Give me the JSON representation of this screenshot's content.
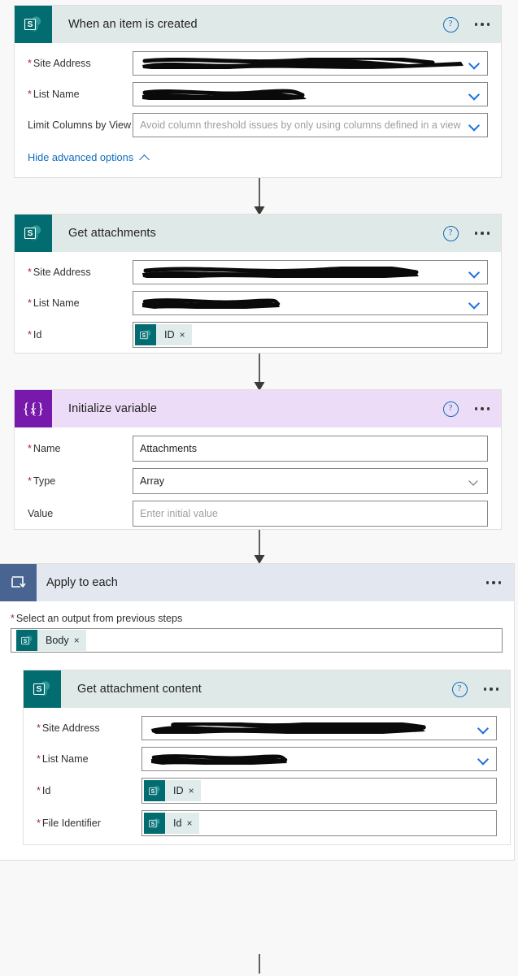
{
  "steps": [
    {
      "id": "when-item-created",
      "title": "When an item is created",
      "connector": "sharepoint",
      "icon": "sharepoint-icon",
      "help_icon": "help-icon",
      "more_icon": "more-options-icon",
      "fields": [
        {
          "label": "Site Address",
          "required": true,
          "type": "redacted",
          "chevron": "blue"
        },
        {
          "label": "List Name",
          "required": true,
          "type": "redacted",
          "chevron": "blue"
        },
        {
          "label": "Limit Columns by View",
          "required": false,
          "type": "placeholder",
          "placeholder": "Avoid column threshold issues by only using columns defined in a view",
          "chevron": "blue"
        }
      ],
      "advanced_link": "Hide advanced options"
    },
    {
      "id": "get-attachments",
      "title": "Get attachments",
      "connector": "sharepoint",
      "icon": "sharepoint-icon",
      "help_icon": "help-icon",
      "more_icon": "more-options-icon",
      "fields": [
        {
          "label": "Site Address",
          "required": true,
          "type": "redacted",
          "chevron": "blue"
        },
        {
          "label": "List Name",
          "required": true,
          "type": "redacted",
          "chevron": "blue"
        },
        {
          "label": "Id",
          "required": true,
          "type": "token",
          "token": {
            "label": "ID",
            "icon": "sharepoint-icon",
            "remove": "×"
          }
        }
      ]
    },
    {
      "id": "initialize-variable",
      "title": "Initialize variable",
      "connector": "variable",
      "icon": "variable-icon",
      "help_icon": "help-icon",
      "more_icon": "more-options-icon",
      "fields": [
        {
          "label": "Name",
          "required": true,
          "type": "value",
          "value": "Attachments"
        },
        {
          "label": "Type",
          "required": true,
          "type": "value",
          "value": "Array",
          "chevron": "gray"
        },
        {
          "label": "Value",
          "required": false,
          "type": "placeholder",
          "placeholder": "Enter initial value"
        }
      ]
    }
  ],
  "scope": {
    "id": "apply-to-each",
    "title": "Apply to each",
    "icon": "loop-icon",
    "more_icon": "more-options-icon",
    "output_label": "Select an output from previous steps",
    "output_required": true,
    "output_token": {
      "label": "Body",
      "icon": "sharepoint-icon",
      "remove": "×"
    },
    "child": {
      "id": "get-attachment-content",
      "title": "Get attachment content",
      "connector": "sharepoint",
      "icon": "sharepoint-icon",
      "help_icon": "help-icon",
      "more_icon": "more-options-icon",
      "fields": [
        {
          "label": "Site Address",
          "required": true,
          "type": "redacted",
          "chevron": "blue"
        },
        {
          "label": "List Name",
          "required": true,
          "type": "redacted",
          "chevron": "blue"
        },
        {
          "label": "Id",
          "required": true,
          "type": "token",
          "token": {
            "label": "ID",
            "icon": "sharepoint-icon",
            "remove": "×"
          }
        },
        {
          "label": "File Identifier",
          "required": true,
          "type": "token",
          "token": {
            "label": "Id",
            "icon": "sharepoint-icon",
            "remove": "×"
          }
        }
      ]
    }
  },
  "colors": {
    "sharepoint_teal": "#036c70",
    "sharepoint_header": "#dfe9e8",
    "variable_purple": "#7719aa",
    "variable_header": "#eddcf7",
    "scope_blue": "#4a6491",
    "scope_header": "#e2e7f0",
    "token_bg": "#dfeceb",
    "link_blue": "#0f6cbd",
    "required_red": "#a4262c",
    "canvas": "#f8f8f8"
  },
  "icons": {
    "sharepoint": "sharepoint-icon",
    "variable": "variable-braces-icon",
    "loop": "loop-arrow-icon",
    "help": "help-circle-icon",
    "more": "ellipsis-icon",
    "chevron_down": "chevron-down-icon",
    "chevron_up": "chevron-up-icon",
    "close": "close-icon",
    "arrow_down": "flow-arrow-down-icon"
  }
}
